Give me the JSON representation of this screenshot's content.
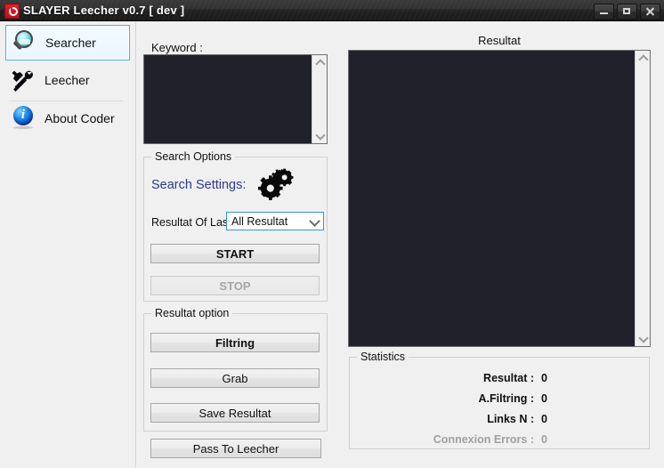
{
  "window": {
    "title": "SLAYER Leecher v0.7 [ dev ]",
    "app_icon": "red-power-icon",
    "controls": {
      "minimize": "minimize-icon",
      "maximize": "maximize-icon",
      "close": "close-icon"
    }
  },
  "sidebar": {
    "items": [
      {
        "label": "Searcher",
        "icon": "magnifier-icon",
        "selected": true
      },
      {
        "label": "Leecher",
        "icon": "hammer-wrench-icon",
        "selected": false
      },
      {
        "label": "About Coder",
        "icon": "info-icon",
        "selected": false
      }
    ]
  },
  "keyword": {
    "label": "Keyword :",
    "value": "",
    "placeholder": ""
  },
  "search_options": {
    "group_title": "Search Options",
    "settings_label": "Search Settings:",
    "settings_icon": "gears-icon",
    "settings_color": "#2b3a8c",
    "last_label": "Resultat Of Last",
    "last_value": "All Resultat",
    "last_options": [
      "All Resultat"
    ],
    "start_label": "START",
    "stop_label": "STOP",
    "stop_enabled": false
  },
  "result_options": {
    "group_title": "Resultat option",
    "filtring_label": "Filtring",
    "grab_label": "Grab",
    "save_label": "Save Resultat"
  },
  "pass_to_leecher_label": "Pass To Leecher",
  "result_panel": {
    "title": "Resultat",
    "content": ""
  },
  "statistics": {
    "group_title": "Statistics",
    "rows": [
      {
        "label": "Resultat :",
        "value": "0",
        "muted": false
      },
      {
        "label": "A.Filtring :",
        "value": "0",
        "muted": false
      },
      {
        "label": "Links N :",
        "value": "0",
        "muted": false
      },
      {
        "label": "Connexion Errors :",
        "value": "0",
        "muted": true
      }
    ]
  },
  "colors": {
    "titlebar_dark": "#2b2b2b",
    "panel_bg": "#f0f0f0",
    "listbox_bg": "#21212b",
    "accent_blue": "#5aacdd",
    "link_blue": "#2b3a8c",
    "disabled_gray": "#a0a0a0"
  }
}
